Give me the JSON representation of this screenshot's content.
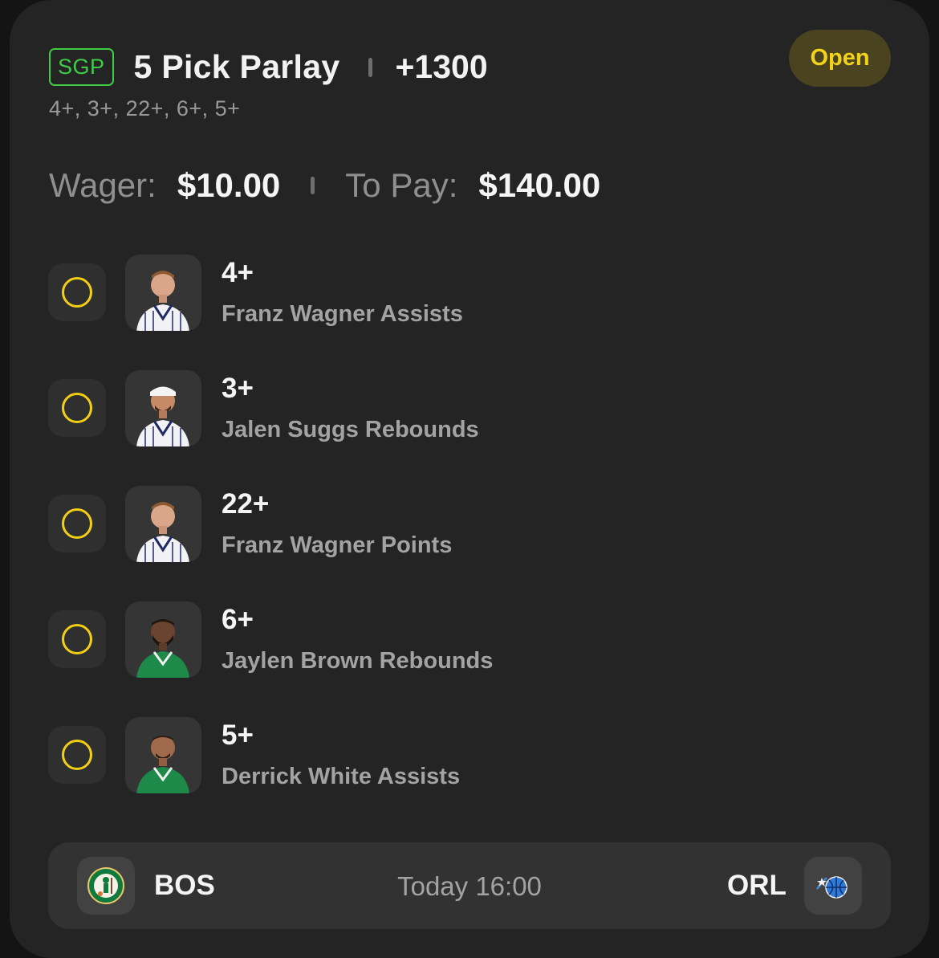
{
  "bet": {
    "badge": "SGP",
    "title": "5 Pick Parlay",
    "odds": "+1300",
    "subtitle": "4+, 3+, 22+, 6+, 5+",
    "status": "Open"
  },
  "wager": {
    "wager_label": "Wager:",
    "wager_value": "$10.00",
    "pay_label": "To Pay:",
    "pay_value": "$140.00"
  },
  "picks": [
    {
      "line": "4+",
      "market": "Franz Wagner Assists",
      "team": "ORL"
    },
    {
      "line": "3+",
      "market": "Jalen Suggs Rebounds",
      "team": "ORL"
    },
    {
      "line": "22+",
      "market": "Franz Wagner Points",
      "team": "ORL"
    },
    {
      "line": "6+",
      "market": "Jaylen Brown Rebounds",
      "team": "BOS"
    },
    {
      "line": "5+",
      "market": "Derrick White Assists",
      "team": "BOS"
    }
  ],
  "game": {
    "home": "BOS",
    "away": "ORL",
    "time": "Today 16:00"
  },
  "colors": {
    "accent_green": "#3fcc46",
    "accent_yellow": "#f3cf14",
    "card_bg": "#242424"
  }
}
